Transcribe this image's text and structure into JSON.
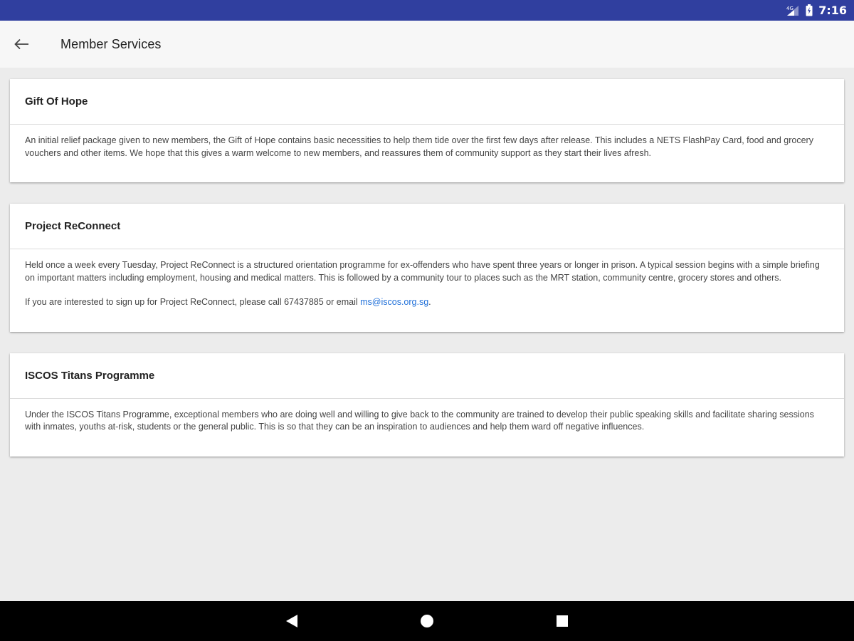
{
  "status_bar": {
    "time": "7:16"
  },
  "app_bar": {
    "title": "Member Services"
  },
  "cards": [
    {
      "title": "Gift Of Hope",
      "paragraphs": [
        "An initial relief package given to new members, the Gift of Hope contains basic necessities to help them tide over the first few days after release. This includes a NETS FlashPay Card, food and grocery vouchers and other items. We hope that this gives a warm welcome to new members, and reassures them of community support as they start their lives afresh."
      ]
    },
    {
      "title": "Project ReConnect",
      "paragraphs": [
        "Held once a week every Tuesday, Project ReConnect is a structured orientation programme for ex-offenders who have spent three years or longer in prison. A typical session begins with a simple briefing on important matters including employment, housing and medical matters. This is followed by a community tour to places such as the MRT station, community centre, grocery stores and others."
      ],
      "contact_text": "If you are interested to sign up for Project ReConnect, please call 67437885 or email ",
      "email": "ms@iscos.org.sg",
      "contact_end": "."
    },
    {
      "title": "ISCOS Titans Programme",
      "paragraphs": [
        "Under the ISCOS Titans Programme, exceptional members who are doing well and willing to give back to the community are trained to develop their public speaking skills and facilitate sharing sessions with inmates, youths at-risk, students or the general public. This is so that they can be an inspiration to audiences and help them ward off negative influences."
      ]
    }
  ],
  "colors": {
    "status_bar": "#303f9f",
    "link": "#1e6fd9",
    "background": "#ececec"
  },
  "icons": {
    "back": "arrow-left-icon",
    "signal": "signal-icon",
    "battery": "battery-icon",
    "nav_back": "triangle-back-icon",
    "nav_home": "circle-home-icon",
    "nav_recents": "square-recents-icon"
  }
}
